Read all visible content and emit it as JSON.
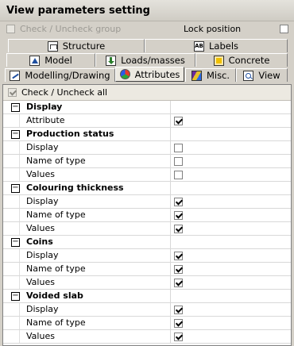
{
  "window": {
    "title": "View parameters setting"
  },
  "top_row": {
    "check_group_label": "Check / Uncheck group",
    "check_group_checked": false,
    "lock_label": "Lock position",
    "lock_checked": false
  },
  "tabs": {
    "row1": [
      {
        "label": "Structure",
        "icon": "structure-icon"
      },
      {
        "label": "Labels",
        "icon": "labels-icon",
        "icon_text": "AB"
      }
    ],
    "row2": [
      {
        "label": "Model",
        "icon": "model-icon"
      },
      {
        "label": "Loads/masses",
        "icon": "loads-icon"
      },
      {
        "label": "Concrete",
        "icon": "concrete-icon"
      }
    ],
    "row3": [
      {
        "label": "Modelling/Drawing",
        "icon": "modelling-icon"
      },
      {
        "label": "Attributes",
        "icon": "attributes-icon",
        "active": true
      },
      {
        "label": "Misc.",
        "icon": "misc-icon"
      },
      {
        "label": "View",
        "icon": "view-icon"
      }
    ]
  },
  "panel": {
    "check_all_label": "Check / Uncheck all",
    "check_all_checked": true,
    "toggle_symbol": "−",
    "sections": [
      {
        "title": "Display",
        "rows": [
          {
            "label": "Attribute",
            "checked": true
          }
        ]
      },
      {
        "title": "Production status",
        "rows": [
          {
            "label": "Display",
            "checked": false
          },
          {
            "label": "Name of type",
            "checked": false
          },
          {
            "label": "Values",
            "checked": false
          }
        ]
      },
      {
        "title": "Colouring thickness",
        "rows": [
          {
            "label": "Display",
            "checked": true
          },
          {
            "label": "Name of type",
            "checked": true
          },
          {
            "label": "Values",
            "checked": true
          }
        ]
      },
      {
        "title": "Coins",
        "rows": [
          {
            "label": "Display",
            "checked": true
          },
          {
            "label": "Name of type",
            "checked": true
          },
          {
            "label": "Values",
            "checked": true
          }
        ]
      },
      {
        "title": "Voided slab",
        "rows": [
          {
            "label": "Display",
            "checked": true
          },
          {
            "label": "Name of type",
            "checked": true
          },
          {
            "label": "Values",
            "checked": true
          }
        ]
      }
    ]
  }
}
